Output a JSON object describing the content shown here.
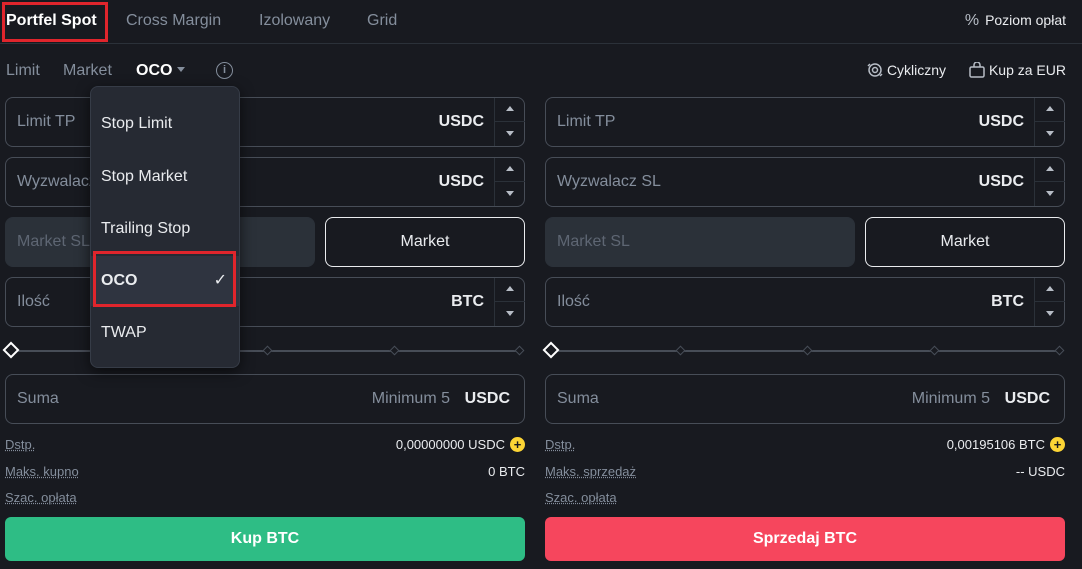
{
  "tabs": [
    {
      "label": "Portfel Spot",
      "active": true
    },
    {
      "label": "Cross Margin",
      "active": false
    },
    {
      "label": "Izolowany",
      "active": false
    },
    {
      "label": "Grid",
      "active": false
    }
  ],
  "fee": {
    "icon": "percent-icon",
    "label": "Poziom opłat"
  },
  "order_types": {
    "limit": "Limit",
    "market": "Market",
    "oco": "OCO"
  },
  "header_links": {
    "recurring": "Cykliczny",
    "buy_eur": "Kup za EUR"
  },
  "dropdown": {
    "items": [
      {
        "label": "Stop Limit"
      },
      {
        "label": "Stop Market"
      },
      {
        "label": "Trailing Stop"
      },
      {
        "label": "OCO",
        "selected": true
      },
      {
        "label": "TWAP"
      }
    ]
  },
  "buy": {
    "limit_tp": {
      "label": "Limit TP",
      "unit": "USDC"
    },
    "trigger": {
      "label": "Wyzwalacz SL",
      "unit": "USDC"
    },
    "market_sl": {
      "label": "Market SL",
      "button": "Market"
    },
    "amount": {
      "label": "Ilość",
      "unit": "BTC"
    },
    "sum": {
      "label": "Suma",
      "placeholder": "Minimum 5",
      "unit": "USDC"
    },
    "available": {
      "label": "Dstp.",
      "value": "0,00000000 USDC"
    },
    "max": {
      "label": "Maks. kupno",
      "value": "0 BTC"
    },
    "fee": {
      "label": "Szac. opłata"
    },
    "button": "Kup BTC"
  },
  "sell": {
    "limit_tp": {
      "label": "Limit TP",
      "unit": "USDC"
    },
    "trigger": {
      "label": "Wyzwalacz SL",
      "unit": "USDC"
    },
    "market_sl": {
      "label": "Market SL",
      "button": "Market"
    },
    "amount": {
      "label": "Ilość",
      "unit": "BTC"
    },
    "sum": {
      "label": "Suma",
      "placeholder": "Minimum 5",
      "unit": "USDC"
    },
    "available": {
      "label": "Dstp.",
      "value": "0,00195106 BTC"
    },
    "max": {
      "label": "Maks. sprzedaż",
      "value": "-- USDC"
    },
    "fee": {
      "label": "Szac. opłata"
    },
    "button": "Sprzedaj BTC"
  },
  "colors": {
    "buy": "#2ebd85",
    "sell": "#f6465d",
    "accent": "#fcd535",
    "highlight": "#e0252c"
  }
}
